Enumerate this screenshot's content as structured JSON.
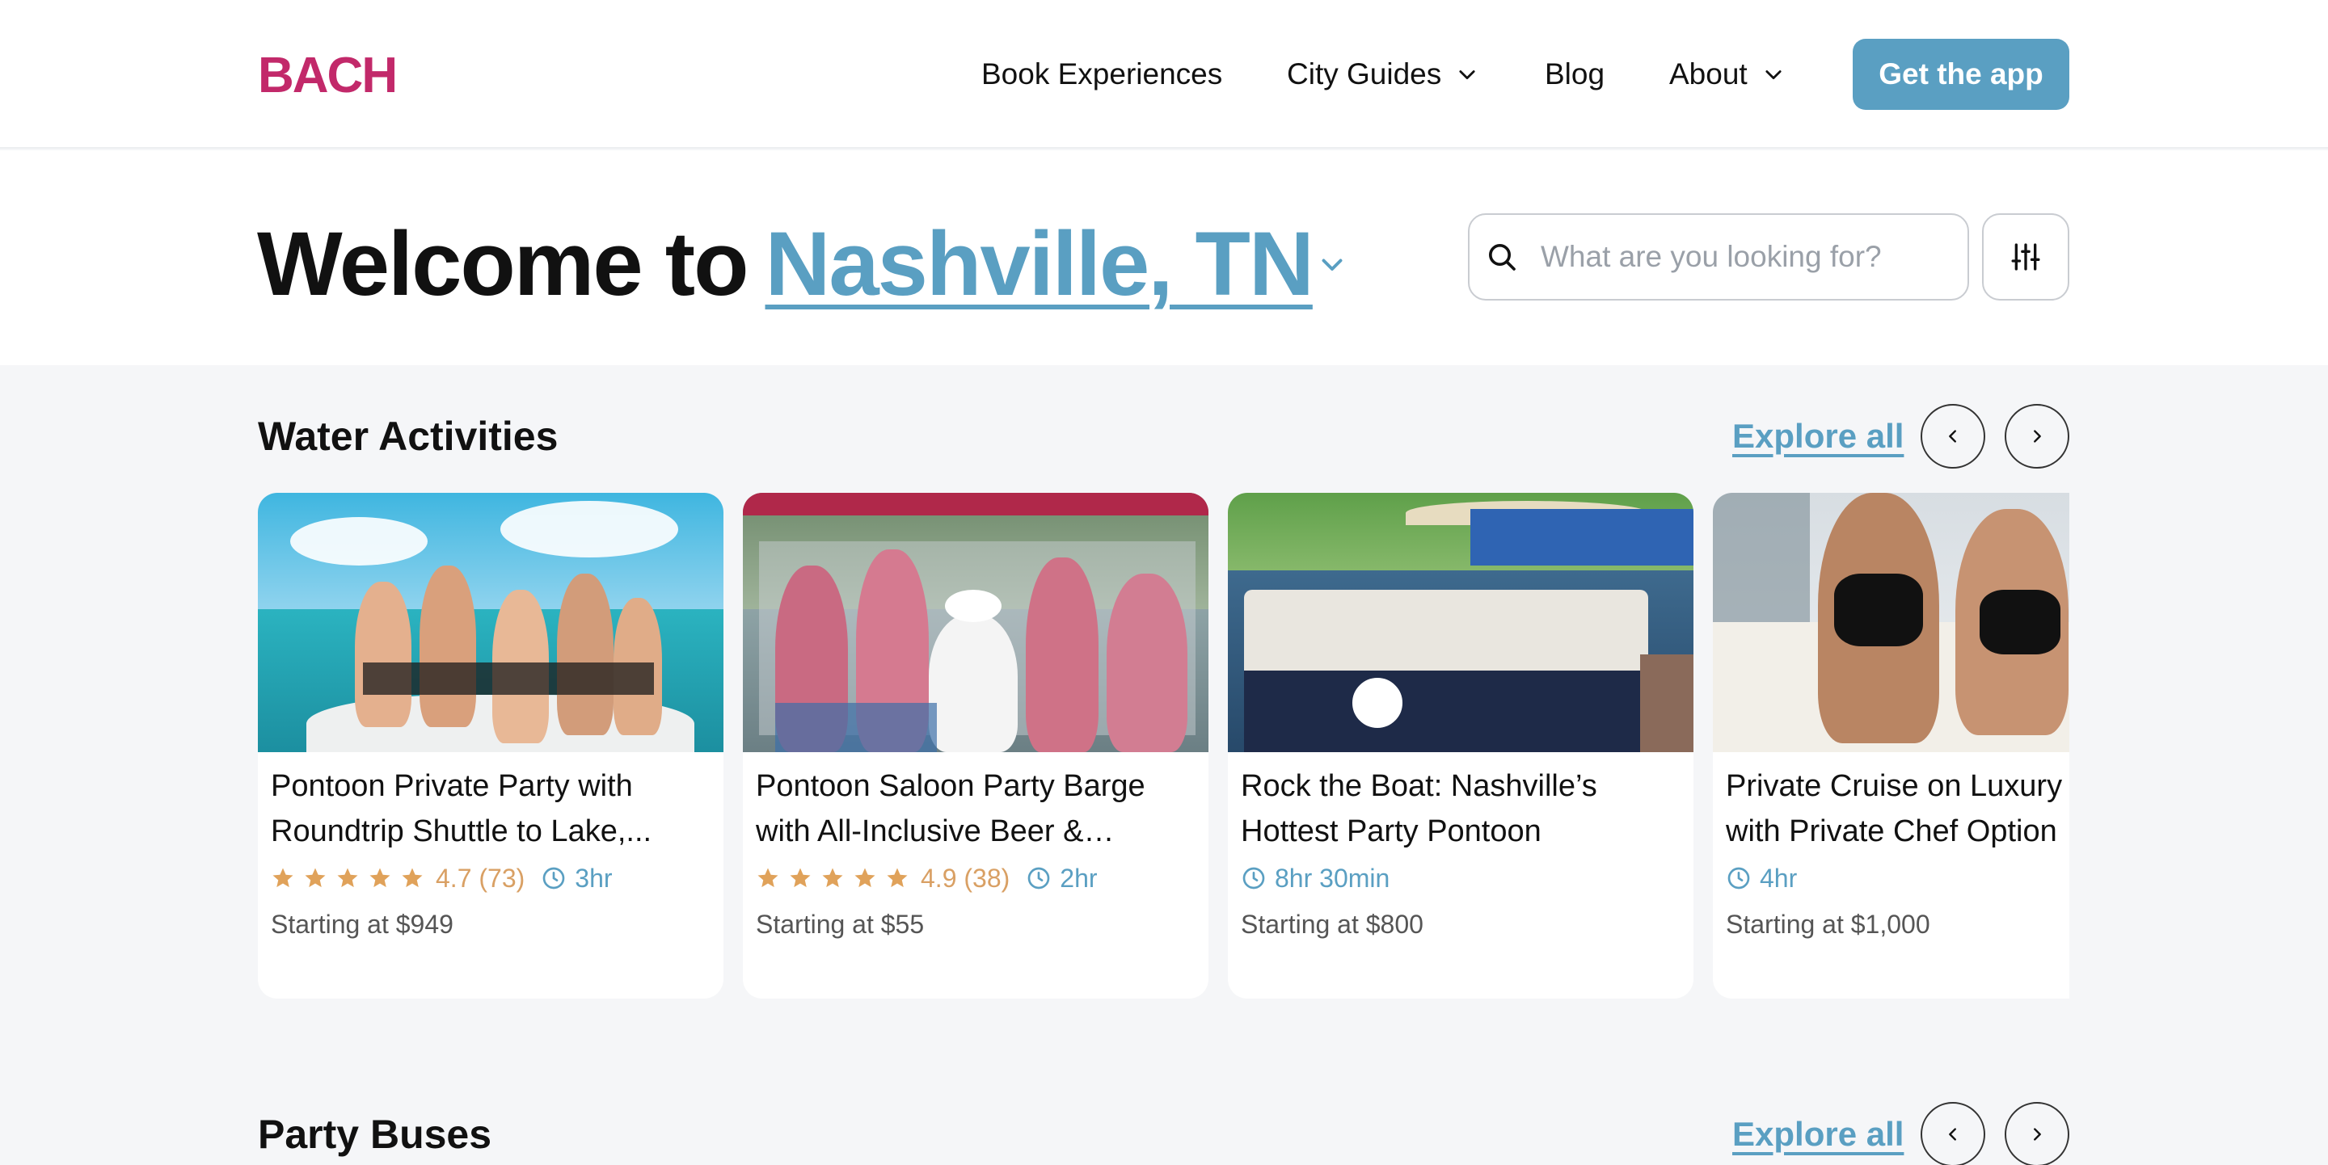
{
  "nav": {
    "logo": "BACH",
    "links": [
      {
        "label": "Book Experiences",
        "has_dropdown": false
      },
      {
        "label": "City Guides",
        "has_dropdown": true
      },
      {
        "label": "Blog",
        "has_dropdown": false
      },
      {
        "label": "About",
        "has_dropdown": true
      }
    ],
    "cta_label": "Get the app"
  },
  "hero": {
    "welcome_prefix": "Welcome to",
    "city": "Nashville, TN",
    "search_placeholder": "What are you looking for?"
  },
  "colors": {
    "brand": "#c2296a",
    "accent": "#5a9fc2",
    "star": "#e0a25a",
    "page_bg": "#f5f6f8"
  },
  "sections": [
    {
      "title": "Water Activities",
      "explore_label": "Explore all",
      "cards": [
        {
          "title": "Pontoon Private Party with Roundtrip Shuttle to Lake,...",
          "stars": 5,
          "rating": "4.7 (73)",
          "duration": "3hr",
          "price": "Starting at $949",
          "image": "group-on-boat-lake-photo"
        },
        {
          "title": "Pontoon Saloon Party Barge with All-Inclusive Beer & Seltzers...",
          "stars": 5,
          "rating": "4.9 (38)",
          "duration": "2hr",
          "price": "Starting at $55",
          "image": "party-barge-group-photo"
        },
        {
          "title": "Rock the Boat: Nashville’s Hottest Party Pontoon",
          "stars": 0,
          "rating": "",
          "duration": "8hr 30min",
          "price": "Starting at $800",
          "image": "pontoon-boat-dock-photo"
        },
        {
          "title": "Private Cruise on Luxury Yacht with Private Chef Option",
          "stars": 0,
          "rating": "",
          "duration": "4hr",
          "price": "Starting at $1,000",
          "image": "yacht-deck-photo"
        }
      ]
    },
    {
      "title": "Party Buses",
      "explore_label": "Explore all",
      "cards": []
    }
  ]
}
